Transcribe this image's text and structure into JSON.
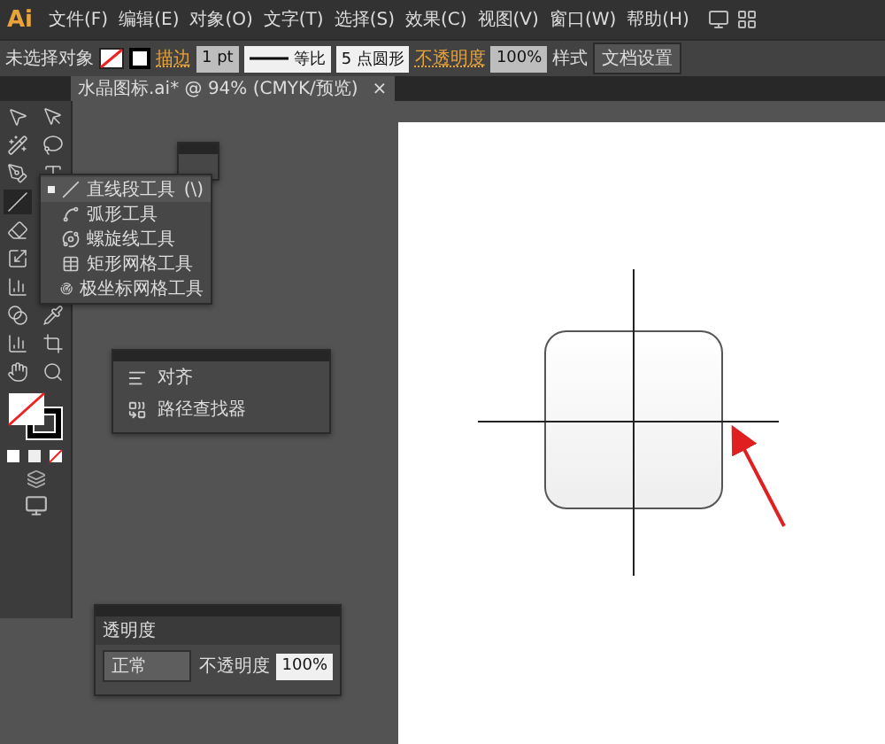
{
  "app": {
    "logo": "Ai"
  },
  "menu": [
    "文件(F)",
    "编辑(E)",
    "对象(O)",
    "文字(T)",
    "选择(S)",
    "效果(C)",
    "视图(V)",
    "窗口(W)",
    "帮助(H)"
  ],
  "control_bar": {
    "selection": "未选择对象",
    "stroke_label": "描边",
    "stroke_weight": "1 pt",
    "profile": "等比",
    "brush": "5 点圆形",
    "opacity_label": "不透明度",
    "opacity": "100%",
    "style_label": "样式",
    "doc_setup": "文档设置"
  },
  "document_tab": {
    "title": "水晶图标.ai* @ 94% (CMYK/预览)",
    "close": "×"
  },
  "tool_flyout": {
    "items": [
      {
        "label": "直线段工具",
        "shortcut": "(\\)",
        "selected": true
      },
      {
        "label": "弧形工具",
        "selected": false
      },
      {
        "label": "螺旋线工具",
        "selected": false
      },
      {
        "label": "矩形网格工具",
        "selected": false
      },
      {
        "label": "极坐标网格工具",
        "selected": false
      }
    ]
  },
  "align_panel": {
    "items": [
      {
        "label": "对齐"
      },
      {
        "label": "路径查找器"
      }
    ]
  },
  "transparency_panel": {
    "title": "透明度",
    "blend_mode": "正常",
    "opacity_label": "不透明度",
    "opacity": "100%"
  }
}
